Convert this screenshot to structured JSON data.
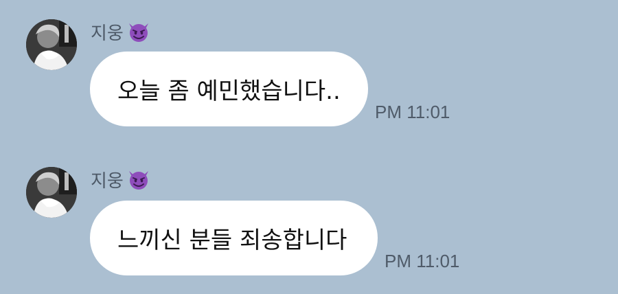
{
  "messages": [
    {
      "sender": "지웅",
      "sender_emoji": "smiling-imp-emoji",
      "text": "오늘 좀 예민했습니다..",
      "time": "PM 11:01"
    },
    {
      "sender": "지웅",
      "sender_emoji": "smiling-imp-emoji",
      "text": "느끼신 분들 죄송합니다",
      "time": "PM 11:01"
    }
  ],
  "colors": {
    "background": "#abbfd1",
    "bubble": "#ffffff",
    "emoji": "#8e4dbb"
  }
}
